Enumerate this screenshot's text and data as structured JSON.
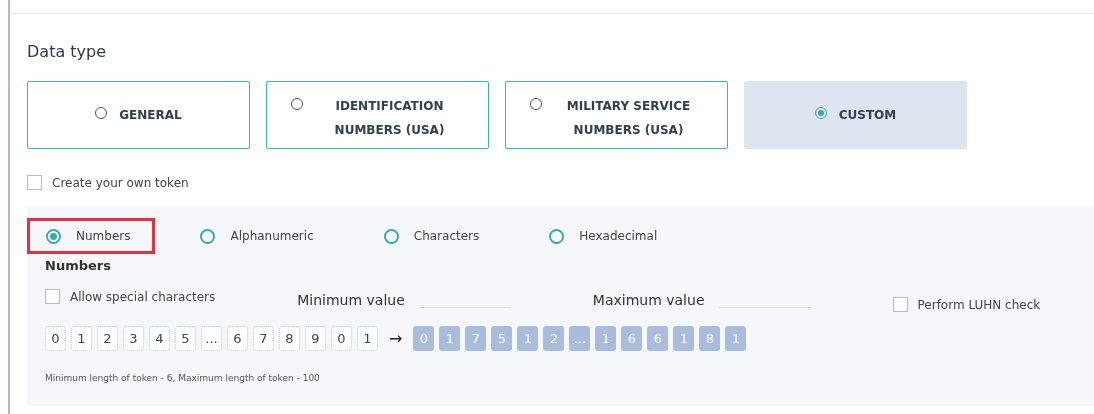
{
  "section_title": "Data type",
  "data_types": [
    {
      "label": "GENERAL",
      "selected": false
    },
    {
      "label": "IDENTIFICATION NUMBERS (USA)",
      "selected": false
    },
    {
      "label": "MILITARY SERVICE NUMBERS (USA)",
      "selected": false
    },
    {
      "label": "CUSTOM",
      "selected": true
    }
  ],
  "own_token": {
    "label": "Create your own token",
    "checked": false
  },
  "formats": [
    {
      "label": "Numbers",
      "selected": true,
      "highlighted": true
    },
    {
      "label": "Alphanumeric",
      "selected": false,
      "highlighted": false
    },
    {
      "label": "Characters",
      "selected": false,
      "highlighted": false
    },
    {
      "label": "Hexadecimal",
      "selected": false,
      "highlighted": false
    }
  ],
  "format_title": "Numbers",
  "allow_special": {
    "label": "Allow special characters",
    "checked": false
  },
  "min_label": "Minimum value",
  "max_label": "Maximum value",
  "luhn": {
    "label": "Perform LUHN check",
    "checked": false
  },
  "source_chars": [
    "0",
    "1",
    "2",
    "3",
    "4",
    "5",
    "...",
    "6",
    "7",
    "8",
    "9",
    "0",
    "1"
  ],
  "arrow": "→",
  "token_chars": [
    "0",
    "1",
    "7",
    "5",
    "1",
    "2",
    "...",
    "1",
    "6",
    "6",
    "1",
    "8",
    "1"
  ],
  "hint": "Minimum length of token - 6, Maximum length of token - 100"
}
